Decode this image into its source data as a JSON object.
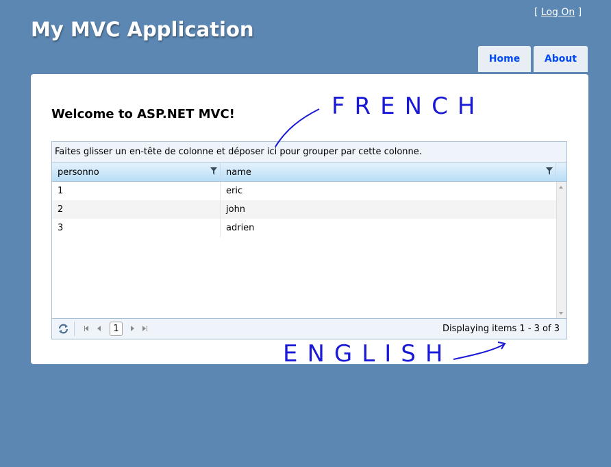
{
  "header": {
    "logon_open": "[ ",
    "logon_link": "Log On",
    "logon_close": " ]",
    "app_title": "My MVC Application"
  },
  "menu": {
    "items": [
      {
        "label": "Home"
      },
      {
        "label": "About"
      }
    ]
  },
  "main": {
    "welcome": "Welcome to ASP.NET MVC!"
  },
  "grid": {
    "group_panel": "Faites glisser un en-tête de colonne et déposer ici pour grouper par cette colonne.",
    "columns": [
      "personno",
      "name"
    ],
    "rows": [
      [
        "1",
        "eric"
      ],
      [
        "2",
        "john"
      ],
      [
        "3",
        "adrien"
      ]
    ],
    "pager": {
      "current_page": "1",
      "info": "Displaying items 1 - 3 of 3"
    }
  },
  "annotations": {
    "french": "FRENCH",
    "english": "ENGLISH"
  },
  "colors": {
    "page_background": "#5c87b2",
    "menu_text": "#034af3",
    "annotation_ink": "#1a1ad6"
  },
  "icons": [
    "filter-icon",
    "refresh-icon",
    "first-page-icon",
    "prev-page-icon",
    "next-page-icon",
    "last-page-icon"
  ]
}
